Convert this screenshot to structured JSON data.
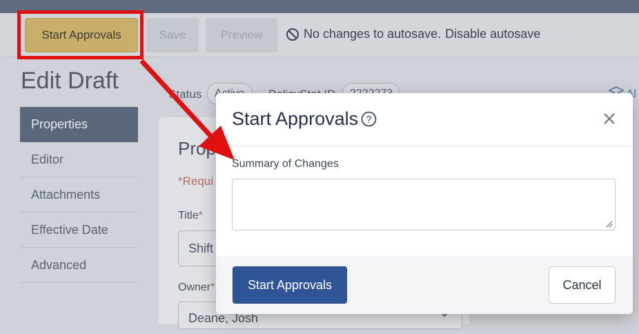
{
  "toolbar": {
    "start_approvals_label": "Start Approvals",
    "save_label": "Save",
    "preview_label": "Preview",
    "autosave_status": "No changes to autosave.",
    "autosave_link": "Disable autosave"
  },
  "page": {
    "title": "Edit Draft"
  },
  "sidebar": {
    "items": [
      {
        "label": "Properties"
      },
      {
        "label": "Editor"
      },
      {
        "label": "Attachments"
      },
      {
        "label": "Effective Date"
      },
      {
        "label": "Advanced"
      }
    ]
  },
  "status_bar": {
    "status_label": "Status",
    "status_value": "Active",
    "policy_id_label": "PolicyStat ID",
    "policy_id_value": "2222273",
    "right_partial": "Al"
  },
  "properties": {
    "title_partial": "Prop",
    "required_partial": "*Requi",
    "title_field_label": "Title",
    "title_field_value_partial": "Shift",
    "owner_field_label": "Owner",
    "owner_value_partial": "Deane, Josh"
  },
  "modal": {
    "title": "Start Approvals",
    "summary_label": "Summary of Changes",
    "summary_value": "",
    "start_button_label": "Start Approvals",
    "cancel_button_label": "Cancel"
  },
  "colors": {
    "annotation": "#e01010",
    "primary_button": "#2f5597",
    "active_nav": "#5b677a"
  }
}
